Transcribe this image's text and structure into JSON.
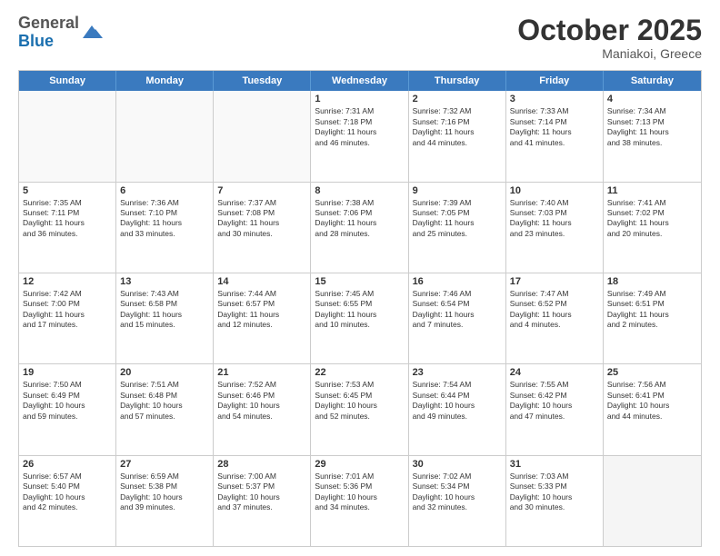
{
  "logo": {
    "general": "General",
    "blue": "Blue"
  },
  "title": "October 2025",
  "location": "Maniakoi, Greece",
  "header_days": [
    "Sunday",
    "Monday",
    "Tuesday",
    "Wednesday",
    "Thursday",
    "Friday",
    "Saturday"
  ],
  "weeks": [
    [
      {
        "day": "",
        "text": ""
      },
      {
        "day": "",
        "text": ""
      },
      {
        "day": "",
        "text": ""
      },
      {
        "day": "1",
        "text": "Sunrise: 7:31 AM\nSunset: 7:18 PM\nDaylight: 11 hours\nand 46 minutes."
      },
      {
        "day": "2",
        "text": "Sunrise: 7:32 AM\nSunset: 7:16 PM\nDaylight: 11 hours\nand 44 minutes."
      },
      {
        "day": "3",
        "text": "Sunrise: 7:33 AM\nSunset: 7:14 PM\nDaylight: 11 hours\nand 41 minutes."
      },
      {
        "day": "4",
        "text": "Sunrise: 7:34 AM\nSunset: 7:13 PM\nDaylight: 11 hours\nand 38 minutes."
      }
    ],
    [
      {
        "day": "5",
        "text": "Sunrise: 7:35 AM\nSunset: 7:11 PM\nDaylight: 11 hours\nand 36 minutes."
      },
      {
        "day": "6",
        "text": "Sunrise: 7:36 AM\nSunset: 7:10 PM\nDaylight: 11 hours\nand 33 minutes."
      },
      {
        "day": "7",
        "text": "Sunrise: 7:37 AM\nSunset: 7:08 PM\nDaylight: 11 hours\nand 30 minutes."
      },
      {
        "day": "8",
        "text": "Sunrise: 7:38 AM\nSunset: 7:06 PM\nDaylight: 11 hours\nand 28 minutes."
      },
      {
        "day": "9",
        "text": "Sunrise: 7:39 AM\nSunset: 7:05 PM\nDaylight: 11 hours\nand 25 minutes."
      },
      {
        "day": "10",
        "text": "Sunrise: 7:40 AM\nSunset: 7:03 PM\nDaylight: 11 hours\nand 23 minutes."
      },
      {
        "day": "11",
        "text": "Sunrise: 7:41 AM\nSunset: 7:02 PM\nDaylight: 11 hours\nand 20 minutes."
      }
    ],
    [
      {
        "day": "12",
        "text": "Sunrise: 7:42 AM\nSunset: 7:00 PM\nDaylight: 11 hours\nand 17 minutes."
      },
      {
        "day": "13",
        "text": "Sunrise: 7:43 AM\nSunset: 6:58 PM\nDaylight: 11 hours\nand 15 minutes."
      },
      {
        "day": "14",
        "text": "Sunrise: 7:44 AM\nSunset: 6:57 PM\nDaylight: 11 hours\nand 12 minutes."
      },
      {
        "day": "15",
        "text": "Sunrise: 7:45 AM\nSunset: 6:55 PM\nDaylight: 11 hours\nand 10 minutes."
      },
      {
        "day": "16",
        "text": "Sunrise: 7:46 AM\nSunset: 6:54 PM\nDaylight: 11 hours\nand 7 minutes."
      },
      {
        "day": "17",
        "text": "Sunrise: 7:47 AM\nSunset: 6:52 PM\nDaylight: 11 hours\nand 4 minutes."
      },
      {
        "day": "18",
        "text": "Sunrise: 7:49 AM\nSunset: 6:51 PM\nDaylight: 11 hours\nand 2 minutes."
      }
    ],
    [
      {
        "day": "19",
        "text": "Sunrise: 7:50 AM\nSunset: 6:49 PM\nDaylight: 10 hours\nand 59 minutes."
      },
      {
        "day": "20",
        "text": "Sunrise: 7:51 AM\nSunset: 6:48 PM\nDaylight: 10 hours\nand 57 minutes."
      },
      {
        "day": "21",
        "text": "Sunrise: 7:52 AM\nSunset: 6:46 PM\nDaylight: 10 hours\nand 54 minutes."
      },
      {
        "day": "22",
        "text": "Sunrise: 7:53 AM\nSunset: 6:45 PM\nDaylight: 10 hours\nand 52 minutes."
      },
      {
        "day": "23",
        "text": "Sunrise: 7:54 AM\nSunset: 6:44 PM\nDaylight: 10 hours\nand 49 minutes."
      },
      {
        "day": "24",
        "text": "Sunrise: 7:55 AM\nSunset: 6:42 PM\nDaylight: 10 hours\nand 47 minutes."
      },
      {
        "day": "25",
        "text": "Sunrise: 7:56 AM\nSunset: 6:41 PM\nDaylight: 10 hours\nand 44 minutes."
      }
    ],
    [
      {
        "day": "26",
        "text": "Sunrise: 6:57 AM\nSunset: 5:40 PM\nDaylight: 10 hours\nand 42 minutes."
      },
      {
        "day": "27",
        "text": "Sunrise: 6:59 AM\nSunset: 5:38 PM\nDaylight: 10 hours\nand 39 minutes."
      },
      {
        "day": "28",
        "text": "Sunrise: 7:00 AM\nSunset: 5:37 PM\nDaylight: 10 hours\nand 37 minutes."
      },
      {
        "day": "29",
        "text": "Sunrise: 7:01 AM\nSunset: 5:36 PM\nDaylight: 10 hours\nand 34 minutes."
      },
      {
        "day": "30",
        "text": "Sunrise: 7:02 AM\nSunset: 5:34 PM\nDaylight: 10 hours\nand 32 minutes."
      },
      {
        "day": "31",
        "text": "Sunrise: 7:03 AM\nSunset: 5:33 PM\nDaylight: 10 hours\nand 30 minutes."
      },
      {
        "day": "",
        "text": ""
      }
    ]
  ]
}
